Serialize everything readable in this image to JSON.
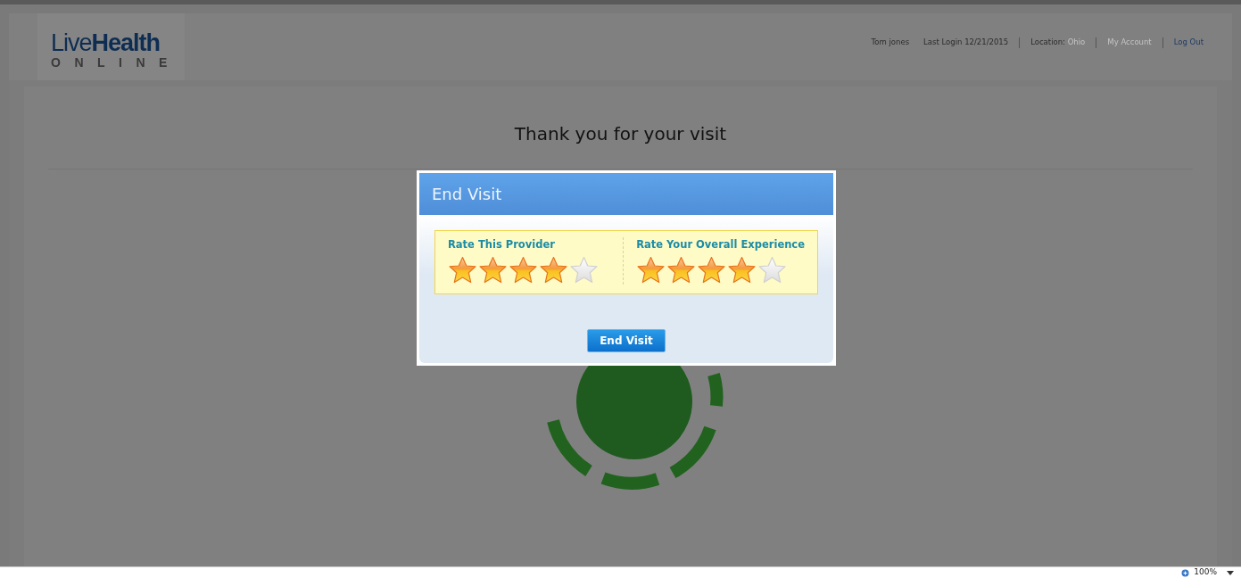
{
  "logo": {
    "brand_light": "Live",
    "brand_bold": "Health",
    "tagline": "ONLINE"
  },
  "header": {
    "user": "Tom jones",
    "last_login": "Last Login 12/21/2015",
    "location_label": "Location:",
    "location_value": "Ohio",
    "links": [
      {
        "label": "My Account",
        "disabled": true
      },
      {
        "label": "Log Out",
        "disabled": false
      }
    ]
  },
  "page_title": "Thank you for your visit",
  "modal": {
    "title": "End Visit",
    "ratings": [
      {
        "label": "Rate This Provider",
        "stars": 4
      },
      {
        "label": "Rate Your Overall Experience",
        "stars": 4
      }
    ],
    "button": "End Visit"
  },
  "status_bar": {
    "zoom": "100%"
  }
}
